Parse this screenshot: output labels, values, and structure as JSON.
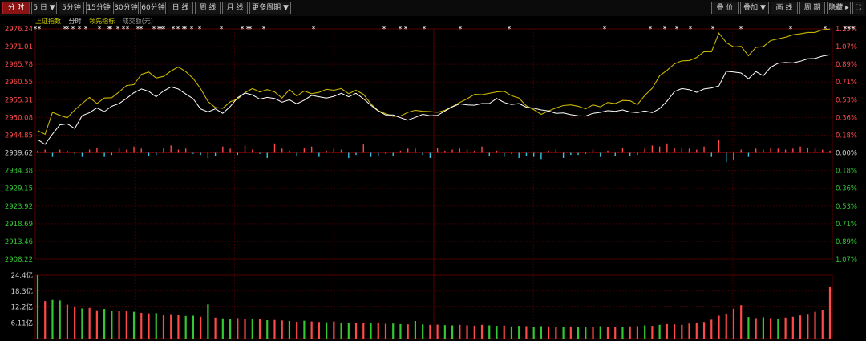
{
  "toolbar": {
    "left_buttons": [
      {
        "label": "分 时",
        "active": true
      },
      {
        "label": "5 日 ▼",
        "active": false
      },
      {
        "label": "5分钟",
        "active": false
      },
      {
        "label": "15分钟",
        "active": false
      },
      {
        "label": "30分钟",
        "active": false
      },
      {
        "label": "60分钟",
        "active": false
      },
      {
        "label": "日 线",
        "active": false
      },
      {
        "label": "周 线",
        "active": false
      },
      {
        "label": "月 线",
        "active": false
      },
      {
        "label": "更多周期 ▼",
        "active": false
      }
    ],
    "right_buttons": [
      {
        "label": "叠 价"
      },
      {
        "label": "叠加 ▼"
      },
      {
        "label": "画 线"
      },
      {
        "label": "周 期"
      },
      {
        "label": "隐藏 ▸"
      },
      {
        "label": "⛶"
      }
    ]
  },
  "legend_tabs": [
    {
      "label": "上证指数",
      "color": "#d4d400"
    },
    {
      "label": "分时",
      "color": "#cfcfcf"
    },
    {
      "label": "领先指标",
      "color": "#d4d400"
    },
    {
      "label": "成交额(元)",
      "color": "#9a9a9a"
    }
  ],
  "colors": {
    "up": "#ff4a4a",
    "down": "#34c734",
    "price_line": "#ffffff",
    "lead_line": "#c8b400",
    "cyan_bar": "#30c8e0",
    "grid": "#3a0000"
  },
  "price_axis_labels": [
    "2976.24",
    "2971.01",
    "2965.78",
    "2960.55",
    "2955.31",
    "2950.08",
    "2944.85",
    "2939.62",
    "2934.38",
    "2929.15",
    "2923.92",
    "2918.69",
    "2913.46",
    "2908.22"
  ],
  "pct_axis_labels": [
    "1.25%",
    "1.07%",
    "0.89%",
    "0.71%",
    "0.53%",
    "0.36%",
    "0.18%",
    "0.00%",
    "0.18%",
    "0.36%",
    "0.53%",
    "0.71%",
    "0.89%",
    "1.07%"
  ],
  "volume_axis_labels": [
    "24.4亿",
    "18.3亿",
    "12.2亿",
    "6.11亿"
  ],
  "chart_data": {
    "type": "line",
    "series": [
      {
        "values": [
          2943.5,
          2942.1,
          2945.2,
          2947.9,
          2948.2,
          2946.8,
          2950.6,
          2951.5,
          2952.9,
          2951.8,
          2953.4,
          2954.2,
          2955.7,
          2957.4,
          2958.5,
          2957.8,
          2956.2,
          2957.9,
          2959.1,
          2958.5,
          2957.0,
          2955.6,
          2952.6,
          2951.7,
          2952.6,
          2951.3,
          2953.3,
          2955.9,
          2957.3,
          2956.7,
          2955.5,
          2956.0,
          2955.7,
          2954.6,
          2955.3,
          2954.1,
          2955.2,
          2956.6,
          2956.2,
          2955.8,
          2956.3,
          2957.2,
          2956.2,
          2957.2,
          2955.6,
          2953.7,
          2952.0,
          2950.8,
          2950.8,
          2950.0,
          2949.3,
          2950.1,
          2951.0,
          2950.6,
          2950.7,
          2952.0,
          2953.2,
          2954.1,
          2953.8,
          2953.7,
          2954.2,
          2954.2,
          2955.7,
          2954.5,
          2953.9,
          2954.2,
          2953.1,
          2952.8,
          2952.3,
          2952.0,
          2951.3,
          2951.4,
          2950.9,
          2950.6,
          2950.5,
          2951.3,
          2951.6,
          2952.1,
          2951.9,
          2952.3,
          2951.7,
          2951.5,
          2952.0,
          2951.5,
          2952.7,
          2954.9,
          2957.7,
          2958.6,
          2958.3,
          2957.5,
          2958.5,
          2958.8,
          2959.4,
          2963.7,
          2963.5,
          2963.2,
          2961.5,
          2963.6,
          2962.4,
          2964.9,
          2966.1,
          2966.3,
          2966.2,
          2966.7,
          2967.4,
          2967.5,
          2968.2,
          2968.6
        ],
        "name": "分时"
      },
      {
        "values": [
          2946.2,
          2945.1,
          2951.6,
          2950.7,
          2950.0,
          2952.3,
          2954.2,
          2956.0,
          2954.2,
          2955.8,
          2955.9,
          2957.6,
          2959.5,
          2959.8,
          2962.8,
          2963.5,
          2961.7,
          2962.2,
          2963.8,
          2965.0,
          2963.6,
          2961.6,
          2958.6,
          2954.8,
          2953.0,
          2952.8,
          2954.7,
          2955.5,
          2957.4,
          2958.6,
          2957.6,
          2958.3,
          2957.6,
          2955.8,
          2958.3,
          2956.4,
          2957.9,
          2957.1,
          2957.5,
          2958.4,
          2958.1,
          2958.6,
          2957.1,
          2958.1,
          2956.9,
          2954.1,
          2952.1,
          2951.2,
          2950.4,
          2950.5,
          2951.6,
          2952.2,
          2951.9,
          2951.8,
          2951.6,
          2952.2,
          2953.3,
          2954.5,
          2955.6,
          2956.9,
          2956.8,
          2957.2,
          2957.6,
          2957.8,
          2956.5,
          2955.8,
          2953.5,
          2952.4,
          2951.0,
          2952.0,
          2952.9,
          2953.6,
          2953.8,
          2953.4,
          2952.6,
          2953.8,
          2953.2,
          2954.5,
          2954.2,
          2955.1,
          2955.0,
          2953.9,
          2956.6,
          2958.7,
          2962.4,
          2964.0,
          2965.9,
          2966.8,
          2966.9,
          2967.8,
          2969.5,
          2969.5,
          2975.0,
          2972.2,
          2970.9,
          2971.1,
          2968.3,
          2970.8,
          2971.0,
          2972.8,
          2973.3,
          2973.8,
          2974.5,
          2974.8,
          2975.2,
          2975.2,
          2976.0,
          2976.2
        ],
        "name": "领先指标"
      }
    ],
    "lead_bars": [
      2,
      3,
      4,
      3,
      2,
      1,
      4,
      3,
      5,
      4,
      2,
      5,
      3,
      6,
      4,
      3,
      2,
      5,
      7,
      3,
      4,
      1,
      2,
      5,
      3,
      6,
      4,
      2,
      7,
      3,
      1,
      5,
      9,
      4,
      2,
      3,
      5,
      6,
      4,
      2,
      4,
      3,
      5,
      2,
      8,
      4,
      3,
      1,
      3,
      2,
      4,
      4,
      2,
      5,
      5,
      2,
      3,
      4,
      3,
      2,
      6,
      3,
      2,
      4,
      1,
      5,
      3,
      4,
      6,
      2,
      3,
      5,
      2,
      2,
      1,
      3,
      4,
      2,
      3,
      5,
      3,
      2,
      4,
      7,
      6,
      9,
      5,
      5,
      4,
      3,
      6,
      4,
      12,
      9,
      7,
      3,
      4,
      4,
      3,
      5,
      4,
      3,
      4,
      6,
      5,
      4,
      3,
      2
    ],
    "lead_bars_dir": [
      1,
      1,
      -1,
      1,
      1,
      -1,
      -1,
      1,
      1,
      -1,
      -1,
      1,
      1,
      1,
      1,
      -1,
      -1,
      1,
      1,
      1,
      1,
      -1,
      -1,
      -1,
      -1,
      1,
      1,
      -1,
      1,
      1,
      -1,
      -1,
      1,
      1,
      1,
      -1,
      1,
      1,
      -1,
      1,
      1,
      1,
      -1,
      -1,
      1,
      -1,
      -1,
      -1,
      -1,
      1,
      1,
      1,
      -1,
      -1,
      1,
      1,
      1,
      1,
      1,
      1,
      1,
      -1,
      1,
      -1,
      -1,
      -1,
      -1,
      -1,
      -1,
      1,
      1,
      -1,
      -1,
      -1,
      -1,
      1,
      -1,
      1,
      -1,
      1,
      -1,
      -1,
      1,
      1,
      1,
      1,
      1,
      1,
      1,
      1,
      1,
      -1,
      1,
      -1,
      -1,
      1,
      -1,
      1,
      1,
      1,
      1,
      1,
      1,
      1,
      1,
      1,
      1,
      1
    ],
    "volume": [
      24.4,
      14.5,
      14.9,
      14.7,
      13.1,
      12.1,
      11.6,
      11.8,
      10.9,
      11.4,
      10.6,
      10.8,
      10.5,
      10.3,
      9.9,
      9.7,
      9.8,
      9.2,
      9.4,
      9.0,
      8.7,
      8.8,
      8.4,
      13.2,
      8.1,
      7.8,
      7.7,
      7.9,
      7.5,
      7.4,
      7.6,
      7.1,
      7.2,
      7.0,
      6.8,
      6.5,
      6.9,
      6.6,
      6.4,
      6.3,
      6.6,
      6.1,
      6.2,
      6.0,
      6.1,
      5.9,
      6.2,
      5.7,
      5.8,
      5.6,
      5.5,
      6.8,
      5.5,
      5.3,
      5.4,
      5.2,
      5.1,
      5.3,
      5.1,
      5.0,
      5.3,
      5.1,
      4.9,
      5.0,
      4.7,
      4.9,
      4.8,
      4.6,
      4.8,
      4.7,
      4.5,
      4.6,
      4.7,
      4.5,
      4.4,
      4.6,
      4.8,
      4.4,
      4.6,
      4.5,
      4.7,
      4.8,
      5.1,
      4.9,
      5.3,
      5.6,
      5.5,
      5.3,
      5.8,
      6.1,
      6.4,
      7.3,
      8.8,
      9.6,
      11.5,
      12.9,
      8.3,
      7.9,
      8.2,
      7.9,
      7.5,
      8.1,
      8.4,
      8.9,
      9.5,
      10.3,
      11.1,
      19.8
    ],
    "volume_dir": [
      -1,
      1,
      -1,
      -1,
      1,
      1,
      -1,
      1,
      1,
      -1,
      -1,
      1,
      1,
      -1,
      1,
      1,
      -1,
      1,
      1,
      1,
      -1,
      -1,
      1,
      -1,
      1,
      -1,
      -1,
      1,
      1,
      -1,
      1,
      -1,
      1,
      1,
      -1,
      1,
      -1,
      1,
      1,
      -1,
      1,
      -1,
      -1,
      1,
      1,
      -1,
      1,
      1,
      -1,
      -1,
      1,
      -1,
      -1,
      1,
      1,
      -1,
      -1,
      1,
      1,
      1,
      1,
      -1,
      -1,
      1,
      -1,
      -1,
      1,
      -1,
      -1,
      1,
      1,
      -1,
      1,
      -1,
      -1,
      1,
      -1,
      1,
      1,
      -1,
      1,
      1,
      -1,
      1,
      -1,
      1,
      1,
      1,
      1,
      1,
      1,
      1,
      1,
      1,
      1,
      1,
      -1,
      1,
      -1,
      1,
      -1,
      1,
      1,
      1,
      1,
      1,
      1,
      1
    ],
    "ylim": [
      2908.22,
      2976.24
    ],
    "base_price": 2939.62,
    "volume_ylim": [
      0,
      24.4
    ]
  }
}
